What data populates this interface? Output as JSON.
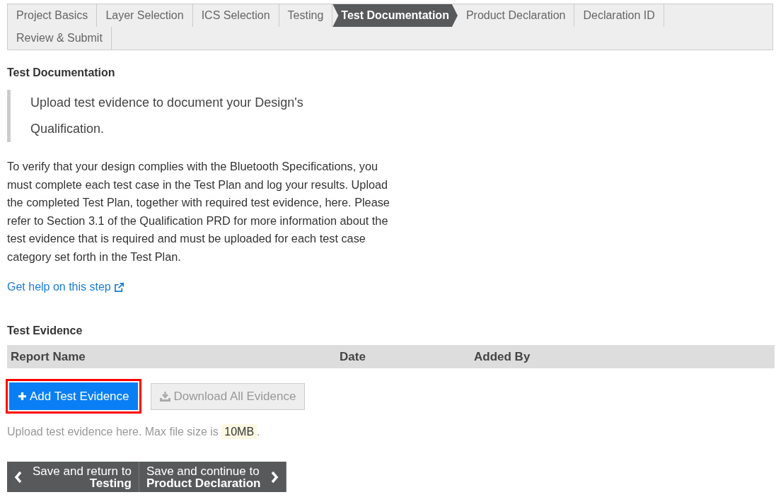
{
  "steps": [
    {
      "label": "Project Basics",
      "selected": false
    },
    {
      "label": "Layer Selection",
      "selected": false
    },
    {
      "label": "ICS Selection",
      "selected": false
    },
    {
      "label": "Testing",
      "selected": false
    },
    {
      "label": "Test Documentation",
      "selected": true
    },
    {
      "label": "Product Declaration",
      "selected": false
    },
    {
      "label": "Declaration ID",
      "selected": false
    },
    {
      "label": "Review & Submit",
      "selected": false
    }
  ],
  "heading": "Test Documentation",
  "quote": "Upload test evidence to document your Design's Qualification.",
  "description": "To verify that your design complies with the Bluetooth Specifications, you must complete each test case in the Test Plan and log your results. Upload the completed Test Plan, together with required test evidence, here. Please refer to Section 3.1 of the Qualification PRD for more information about the test evidence that is required and must be uploaded for each test case category set forth in the Test Plan.",
  "help_link": "Get help on this step",
  "evidence": {
    "title": "Test Evidence",
    "columns": [
      "Report Name",
      "Date",
      "Added By"
    ]
  },
  "buttons": [
    {
      "label": "Add Test Evidence",
      "kind": "primary",
      "highlighted": true
    },
    {
      "label": "Download All Evidence",
      "kind": "disabled",
      "highlighted": false
    }
  ],
  "upload_hint": "Upload test evidence here. Max file size is ",
  "max_size": "10MB",
  "hint_end": ".",
  "nav": [
    {
      "line1": "Save and return to",
      "line2": "Testing",
      "kind": "back"
    },
    {
      "line1": "Save and continue to",
      "line2": "Product Declaration",
      "kind": "next"
    }
  ]
}
